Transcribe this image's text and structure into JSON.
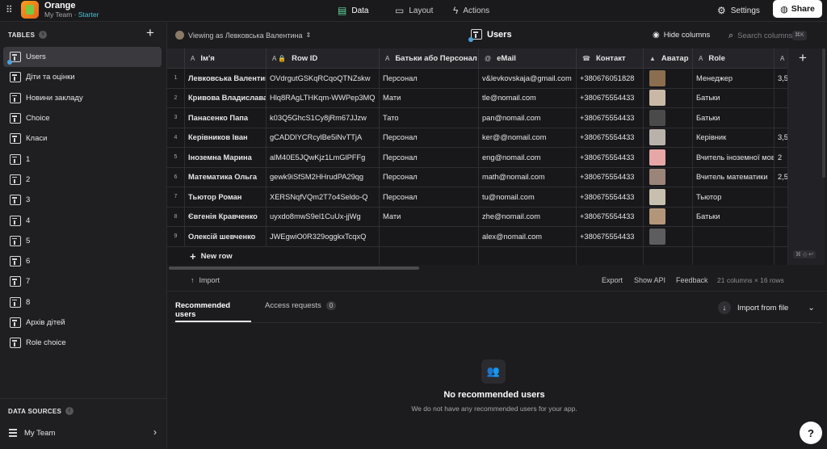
{
  "app": {
    "name": "Orange",
    "team": "My Team",
    "plan": "Starter",
    "logo_icon": "app-logo-icon"
  },
  "topnav": {
    "data": "Data",
    "layout": "Layout",
    "actions": "Actions",
    "settings": "Settings",
    "share": "Share"
  },
  "sidebar": {
    "tables_heading": "TABLES",
    "items": [
      "Users",
      "Діти та оцінки",
      "Новини закладу",
      "Choice",
      "Класи",
      "1",
      "2",
      "3",
      "4",
      "5",
      "6",
      "7",
      "8",
      "Архів дітей",
      "Role choice"
    ],
    "active_index": 0,
    "data_sources_heading": "DATA SOURCES",
    "data_source": "My Team"
  },
  "toolbar": {
    "viewing_as": "Viewing as Левковська Валентина",
    "table_title": "Users",
    "hide_columns": "Hide columns",
    "search_placeholder": "Search columns",
    "search_shortcut": "⌘K"
  },
  "grid": {
    "columns": [
      {
        "label": "Ім'я",
        "icon": "A"
      },
      {
        "label": "Row ID",
        "icon": "A 🔒"
      },
      {
        "label": "Батьки або Персонал",
        "icon": "A"
      },
      {
        "label": "eMail",
        "icon": "@"
      },
      {
        "label": "Контакт",
        "icon": "☎"
      },
      {
        "label": "Аватар",
        "icon": "▲"
      },
      {
        "label": "Role",
        "icon": "A"
      },
      {
        "label": "",
        "icon": "A"
      }
    ],
    "rows": [
      {
        "n": "1",
        "name": "Левковська Валентина",
        "rowid": "OVdrgutGSKqRCqoQTNZskw",
        "type": "Персонал",
        "email": "v&levkovskaja@gmail.com",
        "phone": "+380676051828",
        "role": "Менеджер",
        "extra": "3,5"
      },
      {
        "n": "2",
        "name": "Кривова Владислава",
        "rowid": "Hlq8RAgLTHKqm-WWPep3MQ",
        "type": "Мати",
        "email": "tle@nomail.com",
        "phone": "+380675554433",
        "role": "Батьки",
        "extra": ""
      },
      {
        "n": "3",
        "name": "Панасенко Папа",
        "rowid": "k03Q5GhcS1Cy8jRm67JJzw",
        "type": "Тато",
        "email": "pan@nomail.com",
        "phone": "+380675554433",
        "role": "Батьки",
        "extra": ""
      },
      {
        "n": "4",
        "name": "Керівников Іван",
        "rowid": "gCADDlYCRcylBe5iNvTTjA",
        "type": "Персонал",
        "email": "ker@@nomail.com",
        "phone": "+380675554433",
        "role": "Керівник",
        "extra": "3,5"
      },
      {
        "n": "5",
        "name": "Іноземна Марина",
        "rowid": "alM40E5JQwKjz1LmGlPFFg",
        "type": "Персонал",
        "email": "eng@nomail.com",
        "phone": "+380675554433",
        "role": "Вчитель іноземної мов",
        "extra": "2"
      },
      {
        "n": "6",
        "name": "Математика Ольга",
        "rowid": "gewk9iSfSM2HHrudPA29qg",
        "type": "Персонал",
        "email": "math@nomail.com",
        "phone": "+380675554433",
        "role": "Вчитель математики",
        "extra": "2,5"
      },
      {
        "n": "7",
        "name": "Тьютор Роман",
        "rowid": "XERSNqfVQm2T7o4Seldo-Q",
        "type": "Персонал",
        "email": "tu@nomail.com",
        "phone": "+380675554433",
        "role": "Тьютор",
        "extra": ""
      },
      {
        "n": "8",
        "name": "Євгенія Кравченко",
        "rowid": "uyxdo8mwS9el1CuUx-jjWg",
        "type": "Мати",
        "email": "zhe@nomail.com",
        "phone": "+380675554433",
        "role": "Батьки",
        "extra": ""
      },
      {
        "n": "9",
        "name": "Олексій шевченко",
        "rowid": "JWEgwiO0R329oggkxTcqxQ",
        "type": "",
        "email": "alex@nomail.com",
        "phone": "+380675554433",
        "role": "",
        "extra": ""
      }
    ],
    "avatar_colors": [
      "#8a6e4f",
      "#c9b8a5",
      "#4a4a4a",
      "#b8b2aa",
      "#e7a7a7",
      "#9b8478",
      "#c8bfae",
      "#b3967a",
      "#5d5d60"
    ],
    "new_row": "New row"
  },
  "footer": {
    "import": "Import",
    "export": "Export",
    "show_api": "Show API",
    "feedback": "Feedback",
    "meta": "21 columns × 16 rows"
  },
  "panel": {
    "tab_recommended": "Recommended users",
    "tab_access": "Access requests",
    "access_count": "0",
    "import_from_file": "Import from file",
    "empty_title": "No recommended users",
    "empty_sub": "We do not have any recommended users for your app."
  }
}
